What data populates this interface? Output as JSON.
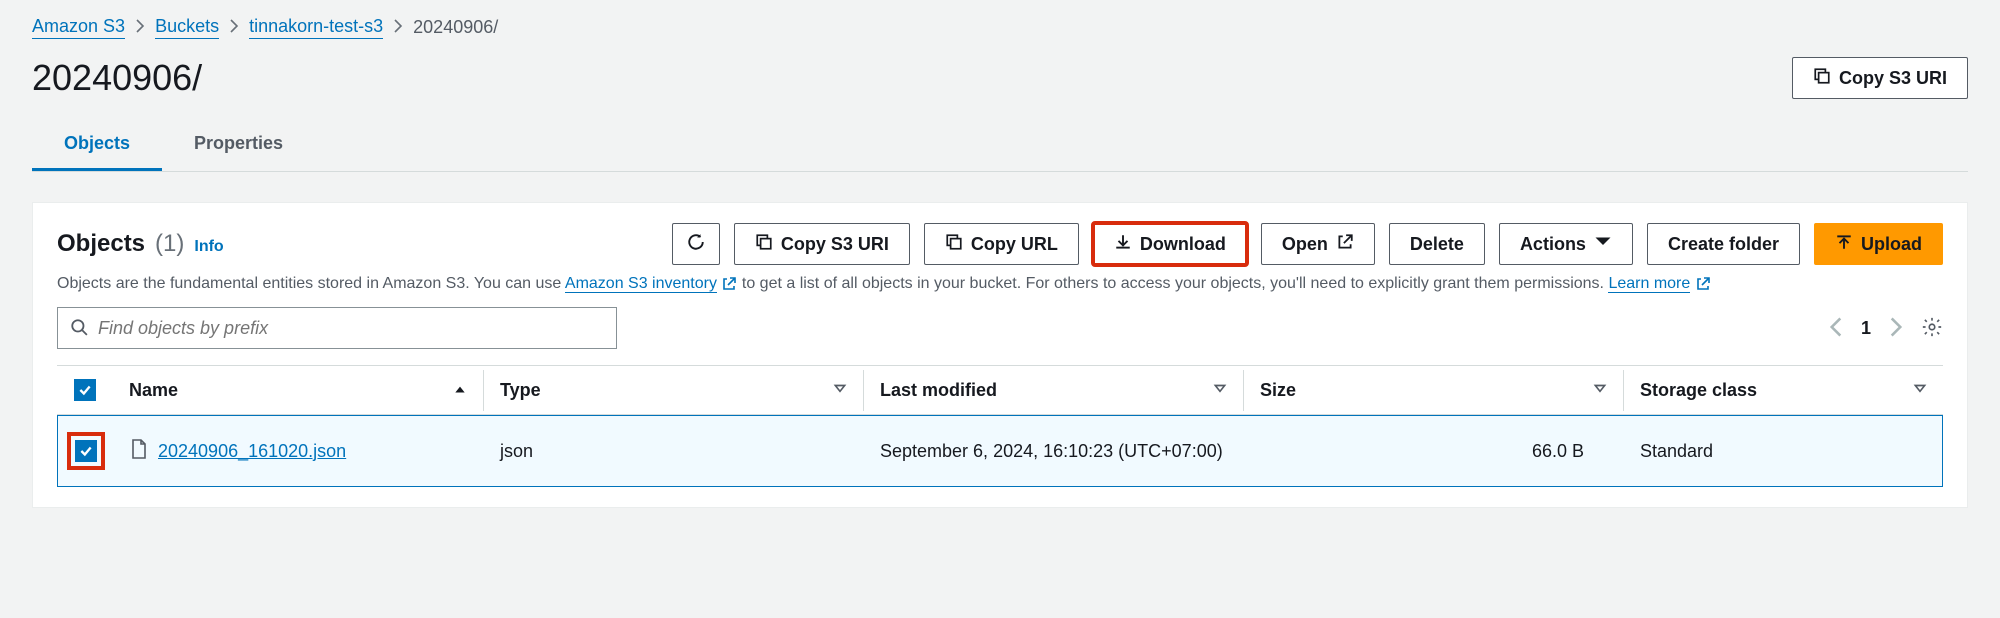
{
  "breadcrumb": {
    "items": [
      "Amazon S3",
      "Buckets",
      "tinnakorn-test-s3"
    ],
    "current": "20240906/"
  },
  "header": {
    "title": "20240906/",
    "copy_uri_label": "Copy S3 URI"
  },
  "tabs": {
    "objects": "Objects",
    "properties": "Properties"
  },
  "objects": {
    "title": "Objects",
    "count": "(1)",
    "info": "Info",
    "toolbar": {
      "copy_uri": "Copy S3 URI",
      "copy_url": "Copy URL",
      "download": "Download",
      "open": "Open",
      "delete": "Delete",
      "actions": "Actions",
      "create_folder": "Create folder",
      "upload": "Upload"
    },
    "desc_prefix": "Objects are the fundamental entities stored in Amazon S3. You can use ",
    "desc_link1": "Amazon S3 inventory",
    "desc_mid": " to get a list of all objects in your bucket. For others to access your objects, you'll need to explicitly grant them permissions. ",
    "desc_link2": "Learn more",
    "search_placeholder": "Find objects by prefix",
    "page_number": "1"
  },
  "table": {
    "columns": {
      "name": "Name",
      "type": "Type",
      "last_modified": "Last modified",
      "size": "Size",
      "storage_class": "Storage class"
    },
    "rows": [
      {
        "name": "20240906_161020.json",
        "type": "json",
        "last_modified": "September 6, 2024, 16:10:23 (UTC+07:00)",
        "size": "66.0 B",
        "storage_class": "Standard"
      }
    ]
  }
}
